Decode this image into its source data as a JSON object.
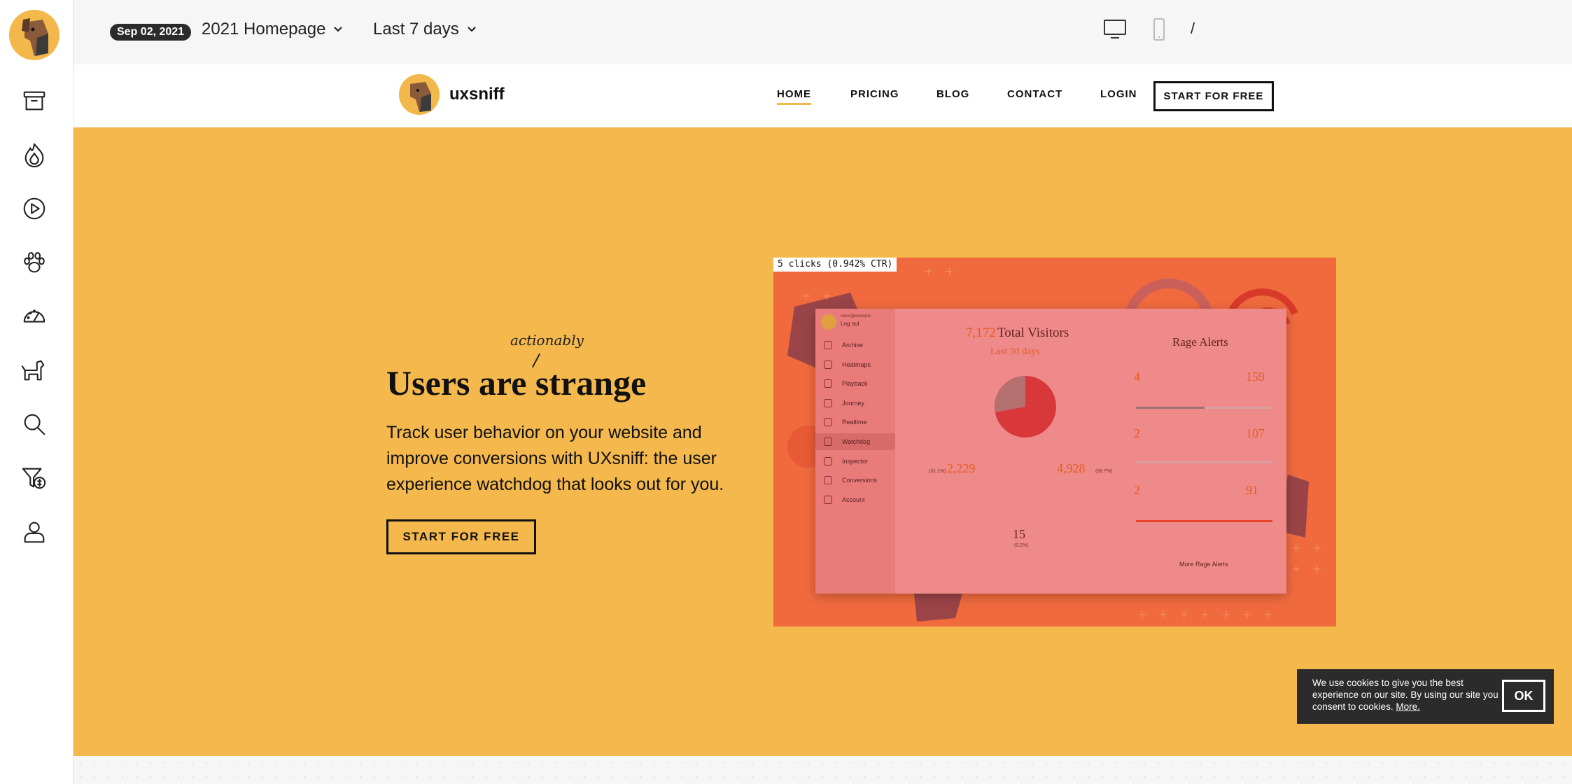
{
  "sidebar": {
    "items": [
      {
        "icon": "archive-icon"
      },
      {
        "icon": "heatmap-flame-icon"
      },
      {
        "icon": "playback-icon"
      },
      {
        "icon": "journey-paw-icon"
      },
      {
        "icon": "realtime-gauge-icon"
      },
      {
        "icon": "watchdog-dog-icon"
      },
      {
        "icon": "inspector-search-icon"
      },
      {
        "icon": "conversions-funnel-icon"
      },
      {
        "icon": "account-user-icon"
      }
    ]
  },
  "toolbar": {
    "date_badge": "Sep 02, 2021",
    "page_select": "2021 Homepage",
    "range_select": "Last 7 days",
    "path": "/"
  },
  "site": {
    "brand": "uxsniff",
    "nav": [
      "HOME",
      "PRICING",
      "BLOG",
      "CONTACT",
      "LOGIN"
    ],
    "nav_cta": "START FOR FREE",
    "accent": "#f4b84c"
  },
  "hero": {
    "annotation": "actionably",
    "title": "Users are strange",
    "subtitle": "Track user behavior on your website and improve conversions with UXsniff: the user experience watchdog that looks out for you.",
    "cta": "START FOR FREE"
  },
  "preview": {
    "clicks_label": "5 clicks (0.942% CTR)",
    "side_user_top": "steve@example",
    "side_logout": "Log out",
    "side_items": [
      "Archive",
      "Heatmaps",
      "Playback",
      "Journey",
      "Realtime",
      "Watchdog",
      "Inspector",
      "Conversions",
      "Account"
    ],
    "visitors_count": "7,172",
    "visitors_label": "Total Visitors",
    "visitors_range": "Last 30 days",
    "stat_left": "2,229",
    "stat_left_pct": "(31.1%)",
    "stat_right": "4,928",
    "stat_right_pct": "(68.7%)",
    "stat_bottom": "15",
    "stat_bottom_pct": "(0.2%)",
    "rage_title": "Rage Alerts",
    "rage_rows": [
      {
        "users": "4",
        "clicks": "159"
      },
      {
        "users": "2",
        "clicks": "107"
      },
      {
        "users": "2",
        "clicks": "91"
      }
    ],
    "more_rage": "More Rage Alerts"
  },
  "cookie": {
    "message": "We use cookies to give you the best experience on our site. By using our site you consent to cookies.",
    "more": "More.",
    "ok": "OK"
  }
}
